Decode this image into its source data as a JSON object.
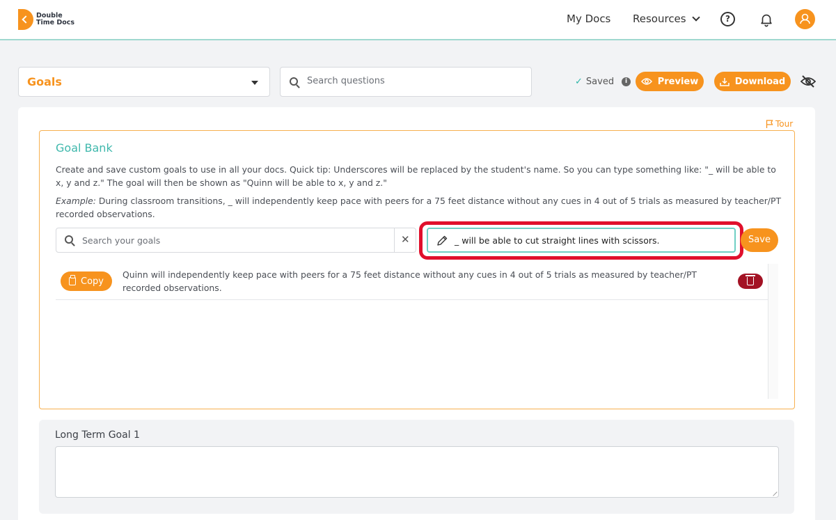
{
  "brand": {
    "line1": "Double",
    "line2": "Time Docs"
  },
  "nav": {
    "my_docs": "My Docs",
    "resources": "Resources"
  },
  "toolbar": {
    "section_select": "Goals",
    "search_placeholder": "Search questions",
    "saved_label": "Saved",
    "preview_label": "Preview",
    "download_label": "Download"
  },
  "tour_label": "Tour",
  "goal_bank": {
    "title": "Goal Bank",
    "description": "Create and save custom goals to use in all your docs. Quick tip: Underscores will be replaced by the student's name. So you can type something like: \"_ will be able to x, y and z.\" The goal will then be shown as \"Quinn will be able to x, y and z.\"",
    "example_label": "Example:",
    "example_text": " During classroom transitions, _ will independently keep pace with peers for a 75 feet distance without any cues in 4 out of 5 trials as measured by teacher/PT recorded observations.",
    "search_placeholder": "Search your goals",
    "clear_symbol": "✕",
    "new_goal_value": "_ will be able to cut straight lines with scissors.",
    "save_label": "Save",
    "goals": [
      {
        "copy_label": "Copy",
        "text": "Quinn will independently keep pace with peers for a 75 feet distance without any cues in 4 out of 5 trials as measured by teacher/PT recorded observations."
      }
    ]
  },
  "long_term_goal": {
    "label": "Long Term Goal 1",
    "value": ""
  },
  "colors": {
    "accent": "#f7931e",
    "teal": "#3fb8ac",
    "danger": "#a31224",
    "highlight": "#e0102c"
  },
  "icons": [
    "logo-icon",
    "chevron-down-icon",
    "help-icon",
    "bell-icon",
    "user-icon",
    "search-icon",
    "check-icon",
    "info-icon",
    "eye-icon",
    "download-icon",
    "eye-off-icon",
    "flag-icon",
    "pencil-icon",
    "clipboard-icon",
    "trash-icon"
  ]
}
